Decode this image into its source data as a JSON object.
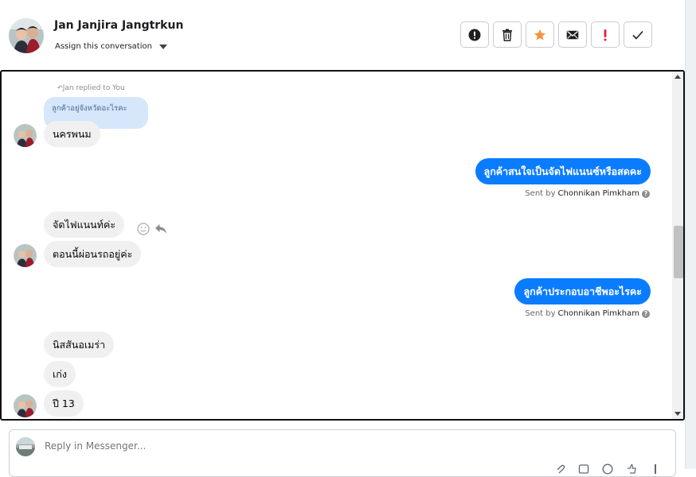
{
  "header": {
    "contact_name": "Jan Janjira Jangtrkun",
    "assign_label": "Assign this conversation",
    "actions": [
      {
        "icon": "alert-circle-icon",
        "name": "mark-spam-button"
      },
      {
        "icon": "trash-icon",
        "name": "delete-button"
      },
      {
        "icon": "star-icon",
        "name": "star-button"
      },
      {
        "icon": "envelope-icon",
        "name": "mark-unread-button"
      },
      {
        "icon": "exclamation-icon",
        "name": "follow-up-button"
      },
      {
        "icon": "check-icon",
        "name": "mark-done-button"
      }
    ],
    "star_color": "#f7923a",
    "alert_color": "#e41e3f"
  },
  "conversation": {
    "replied_label": "Jan replied to You",
    "quoted_text": "ลูกค้าอยู่จังหวัดอะไรคะ",
    "messages": [
      {
        "text": "นครพนม",
        "dir": "in"
      },
      {
        "text": "ลูกค้าสนใจเป็นจัดไฟแนนซ์หรือสดคะ",
        "dir": "out"
      },
      {
        "text": "จัดไฟแนนท์ค่ะ",
        "dir": "in"
      },
      {
        "text": "ตอนนี้ผ่อนรถอยู่ค่ะ",
        "dir": "in"
      },
      {
        "text": "ลูกค้าประกอบอาชีพอะไรคะ",
        "dir": "out"
      },
      {
        "text": "นิสสันอเมร่า",
        "dir": "in"
      },
      {
        "text": "เก่ง",
        "dir": "in"
      },
      {
        "text": "ปี 13",
        "dir": "in"
      }
    ],
    "sent_by_prefix": "Sent by",
    "sent_by_name": "Chonnikan Pimkham",
    "accent": "#0a7cff"
  },
  "reply": {
    "placeholder": "Reply in Messenger..."
  }
}
